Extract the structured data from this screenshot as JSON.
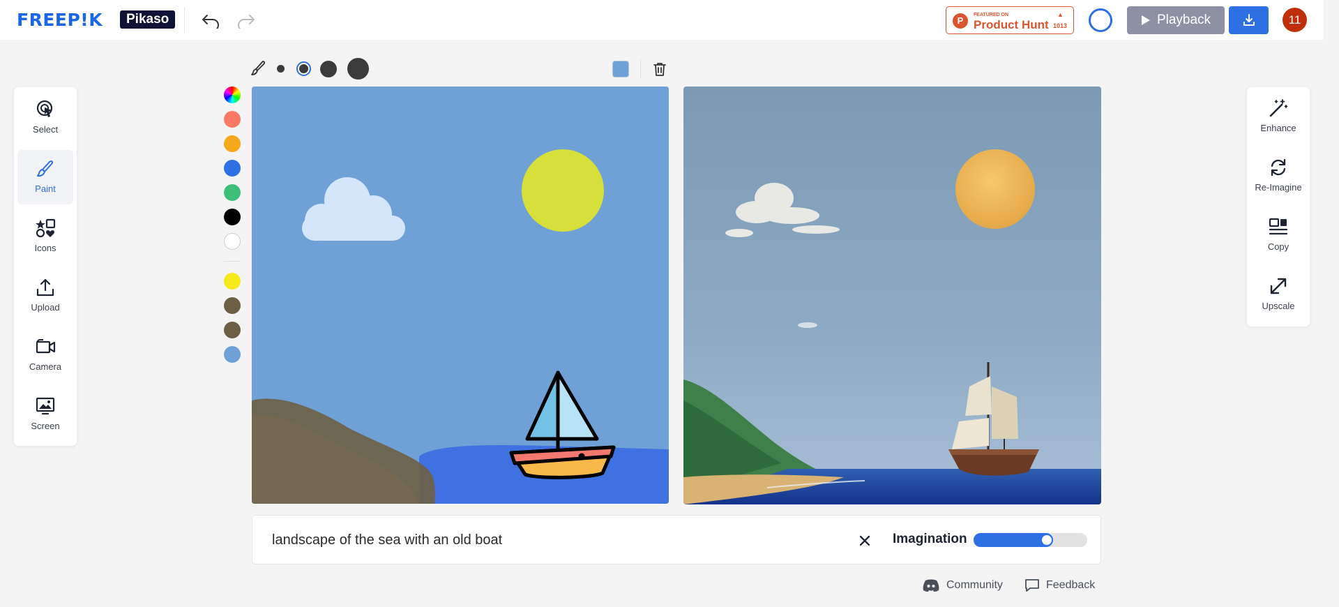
{
  "header": {
    "logo": "FREEP!K",
    "product": "Pikaso",
    "product_hunt": {
      "small_text": "FEATURED ON",
      "title": "Product Hunt",
      "votes": "1013"
    },
    "playback_label": "Playback",
    "avatar_text": "11"
  },
  "left_toolbar": {
    "items": [
      {
        "label": "Select",
        "icon": "select-pointer-icon"
      },
      {
        "label": "Paint",
        "icon": "brush-icon",
        "active": true
      },
      {
        "label": "Icons",
        "icon": "icons-shapes-icon"
      },
      {
        "label": "Upload",
        "icon": "upload-icon"
      },
      {
        "label": "Camera",
        "icon": "camera-icon"
      },
      {
        "label": "Screen",
        "icon": "screen-capture-icon"
      }
    ]
  },
  "right_toolbar": {
    "items": [
      {
        "label": "Enhance",
        "icon": "magic-wand-icon"
      },
      {
        "label": "Re-Imagine",
        "icon": "refresh-icon"
      },
      {
        "label": "Copy",
        "icon": "copy-icon"
      },
      {
        "label": "Upscale",
        "icon": "upscale-arrow-icon"
      }
    ]
  },
  "brush": {
    "sizes": [
      "small",
      "medium",
      "large",
      "x-large"
    ],
    "selected_size": "medium",
    "current_color": "#6fa0d6"
  },
  "palette": {
    "colors": [
      "#fb7a66",
      "#f6a81c",
      "#2f6fe4",
      "#3fbf7a",
      "#000000",
      "#ffffff"
    ],
    "recent_colors": [
      "#f7ea1b",
      "#6d5f45",
      "#6d5f45",
      "#6fa0d6"
    ]
  },
  "prompt": {
    "text": "landscape of the sea with an old boat",
    "imagination_label": "Imagination",
    "imagination_level": 0.66
  },
  "footer": {
    "community_label": "Community",
    "feedback_label": "Feedback"
  },
  "colors": {
    "brand_blue": "#1a66e6",
    "accent_blue": "#2f6fe4",
    "product_hunt": "#da552f",
    "avatar": "#c02f0c"
  }
}
